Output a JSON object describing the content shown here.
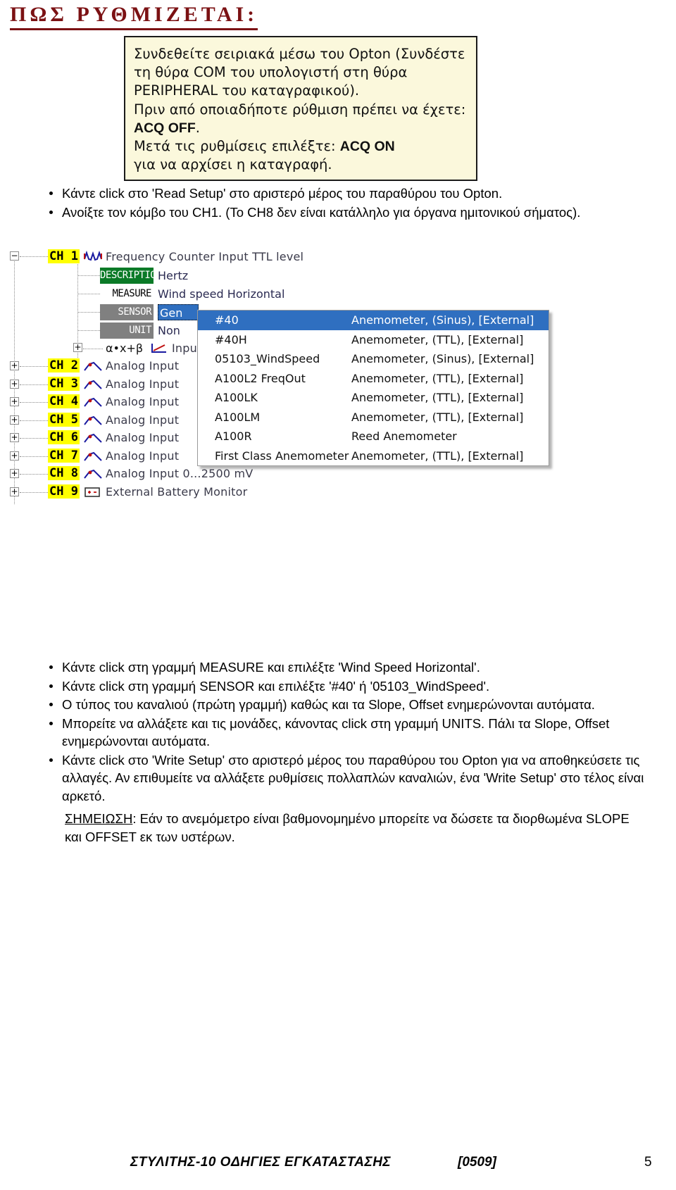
{
  "heading": "ΠΩΣ ΡΥΘΜΙΖΕΤΑΙ:",
  "callout": {
    "line1": "Συνδεθείτε σειριακά μέσω του Opton (Συνδέστε τη θύρα COM του υπολογιστή στη θύρα PERIPHERAL του καταγραφικού).",
    "line2": "Πριν από οποιαδήποτε ρύθμιση πρέπει να έχετε:",
    "acq_off": "ACQ OFF",
    "line2_end": ".",
    "line3_pre": "Μετά τις ρυθμίσεις επιλέξτε: ",
    "acq_on": "ACQ ON",
    "line4": "για να αρχίσει η καταγραφή."
  },
  "bullets_top": [
    "Κάντε click στο 'Read Setup' στο αριστερό μέρος του παραθύρου του Opton.",
    "Ανοίξτε τον κόμβο του CH1. (Το CH8 δεν είναι κατάλληλο για όργανα ημιτονικού σήματος)."
  ],
  "bullets_bottom": [
    "Κάντε click στη γραμμή MEASURE και επιλέξτε 'Wind Speed Horizontal'.",
    "Κάντε click στη γραμμή SENSOR και επιλέξτε '#40' ή '05103_WindSpeed'.",
    "Ο τύπος του καναλιού (πρώτη γραμμή) καθώς και τα Slope, Offset ενημερώνονται αυτόματα.",
    "Μπορείτε να αλλάξετε και τις μονάδες, κάνοντας click στη γραμμή UNITS. Πάλι τα Slope, Offset ενημερώνονται αυτόματα.",
    "Κάντε click στο 'Write Setup' στο αριστερό μέρος του παραθύρου του Opton για να αποθηκεύσετε τις αλλαγές. Αν επιθυμείτε να αλλάξετε ρυθμίσεις πολλαπλών καναλιών, ένα 'Write Setup' στο τέλος είναι αρκετό."
  ],
  "note": {
    "label": "ΣΗΜΕΙΩΣΗ",
    "text": ": Εάν το ανεμόμετρο είναι βαθμονομημένο μπορείτε να δώσετε τα διορθωμένα SLOPE και OFFSET εκ των υστέρων."
  },
  "app": {
    "tree": {
      "ch1": {
        "label": "CH 1",
        "text": "Frequency Counter Input TTL level",
        "expander": "−",
        "icon": "sine-wave-icon"
      },
      "properties": [
        {
          "chip": "DESCRIPTION",
          "value": "Hertz",
          "selected": false
        },
        {
          "chip": "MEASURE",
          "value": "Wind speed Horizontal",
          "selected": false
        },
        {
          "chip": "SENSOR",
          "value": "Gen",
          "selected": true
        },
        {
          "chip": "UNIT",
          "value": "Non",
          "selected": false
        }
      ],
      "formula_row": {
        "symbol": "α•x+β",
        "text": "Inpu",
        "expander": "+",
        "icon": "slope-line-icon"
      },
      "channels": [
        {
          "label": "CH 2",
          "text": "Analog Input",
          "expander": "+",
          "icon": "analog-wave-icon"
        },
        {
          "label": "CH 3",
          "text": "Analog Input",
          "expander": "+",
          "icon": "analog-wave-icon"
        },
        {
          "label": "CH 4",
          "text": "Analog Input",
          "expander": "+",
          "icon": "analog-wave-icon"
        },
        {
          "label": "CH 5",
          "text": "Analog Input",
          "expander": "+",
          "icon": "analog-wave-icon"
        },
        {
          "label": "CH 6",
          "text": "Analog Input",
          "expander": "+",
          "icon": "analog-wave-icon"
        },
        {
          "label": "CH 7",
          "text": "Analog Input",
          "expander": "+",
          "icon": "analog-wave-icon"
        },
        {
          "label": "CH 8",
          "text": "Analog Input 0...2500 mV",
          "expander": "+",
          "icon": "analog-wave-icon"
        },
        {
          "label": "CH 9",
          "text": "External Battery Monitor",
          "expander": "+",
          "icon": "battery-icon"
        }
      ]
    },
    "dropdown": {
      "items": [
        {
          "code": "#40",
          "desc": "Anemometer, (Sinus), [External]",
          "highlighted": true
        },
        {
          "code": "#40H",
          "desc": "Anemometer, (TTL), [External]",
          "highlighted": false
        },
        {
          "code": "05103_WindSpeed",
          "desc": "Anemometer, (Sinus), [External]",
          "highlighted": false
        },
        {
          "code": "A100L2 FreqOut",
          "desc": "Anemometer, (TTL), [External]",
          "highlighted": false
        },
        {
          "code": "A100LK",
          "desc": "Anemometer, (TTL), [External]",
          "highlighted": false
        },
        {
          "code": "A100LM",
          "desc": "Anemometer, (TTL), [External]",
          "highlighted": false
        },
        {
          "code": "A100R",
          "desc": "Reed Anemometer",
          "highlighted": false
        },
        {
          "code": "First Class Anemometer",
          "desc": "Anemometer, (TTL), [External]",
          "highlighted": false
        }
      ]
    }
  },
  "footer": {
    "title": "ΣΤΥΛΙΤΗΣ-10 ΟΔΗΓΙΕΣ ΕΓΚΑΤΑΣΤΑΣΗΣ",
    "code": "[0509]",
    "page": "5"
  },
  "colors": {
    "heading": "#7b1113",
    "callout_bg": "#fbf8dc",
    "highlight_yellow": "#ffff00",
    "selection_blue": "#2f6fc0",
    "chip_green": "#0b7a27",
    "chip_gray": "#808080"
  }
}
